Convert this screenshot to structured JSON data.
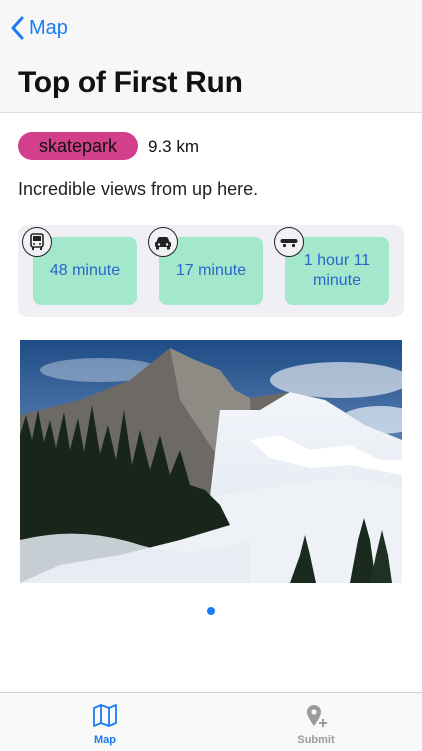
{
  "nav": {
    "back_label": "Map",
    "title": "Top of First Run"
  },
  "place": {
    "category": "skatepark",
    "distance": "9.3 km",
    "description": "Incredible views from up here."
  },
  "transit": [
    {
      "icon": "bus-icon",
      "value": "48 minute"
    },
    {
      "icon": "car-icon",
      "value": "17 minute"
    },
    {
      "icon": "skateboard-icon",
      "value": "1 hour 11 minute"
    }
  ],
  "colors": {
    "accent": "#1a7cf5",
    "tag": "#d2408b",
    "tile": "#a3e8cc",
    "tile_text": "#2a66c9"
  },
  "tabs": [
    {
      "label": "Map",
      "icon": "map-icon",
      "active": true
    },
    {
      "label": "Submit",
      "icon": "add-location-icon",
      "active": false
    }
  ]
}
